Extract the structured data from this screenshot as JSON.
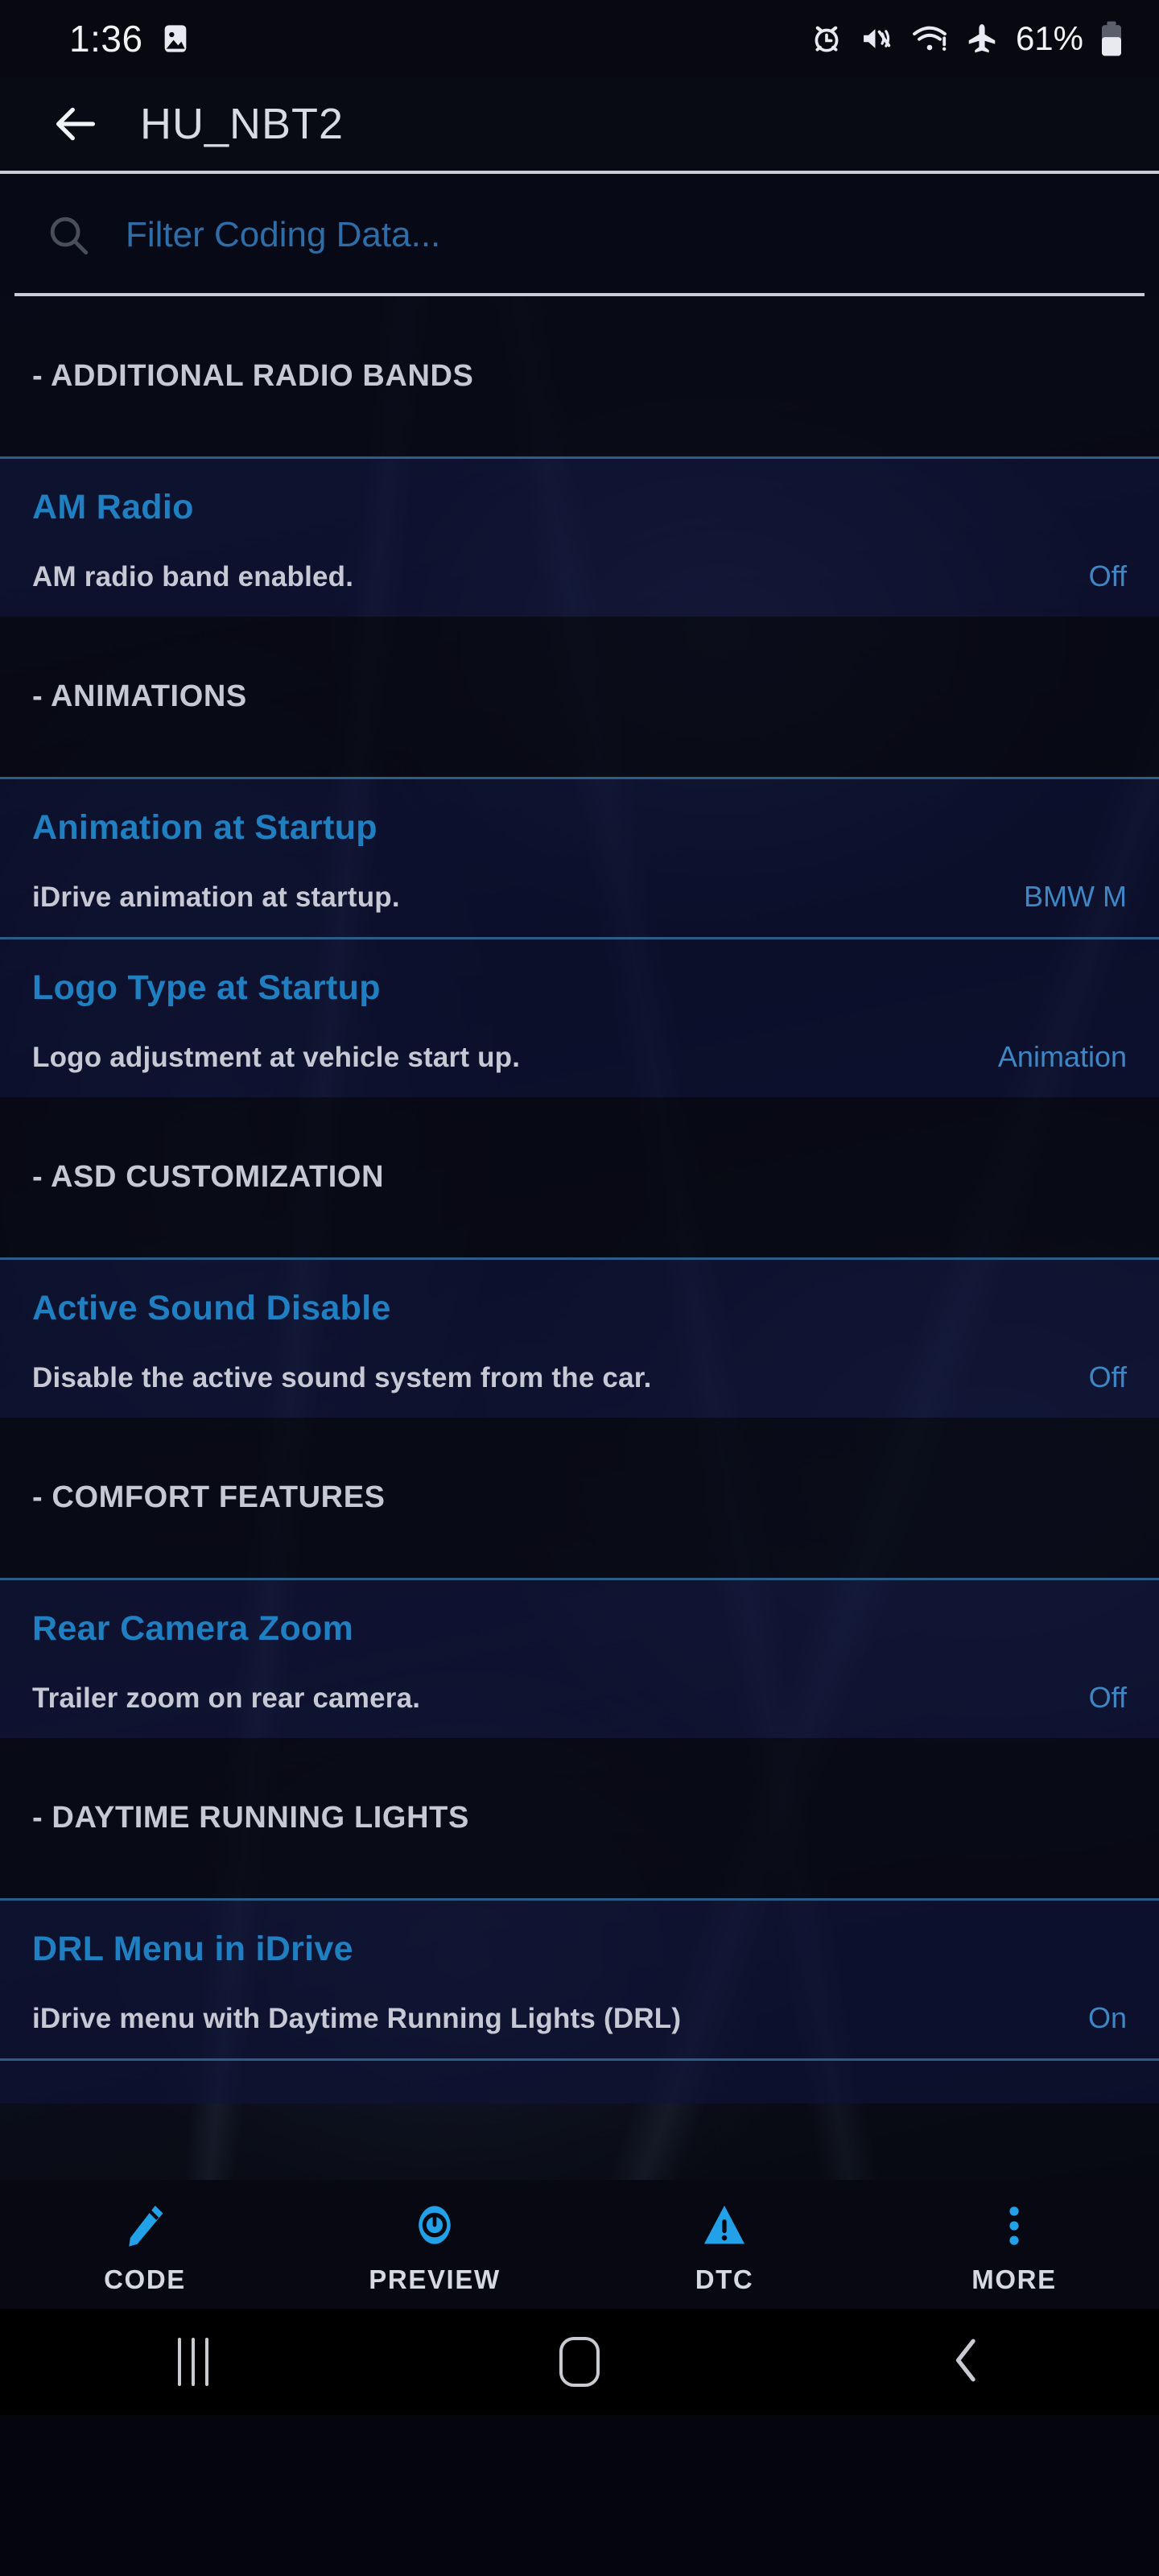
{
  "status_bar": {
    "time": "1:36",
    "battery_percent": "61%",
    "icons": [
      "image-icon",
      "alarm-icon",
      "vibrate-mute-icon",
      "wifi-warning-icon",
      "airplane-mode-icon",
      "battery-icon"
    ]
  },
  "app_bar": {
    "back_icon": "arrow-left-icon",
    "title": "HU_NBT2"
  },
  "search": {
    "icon": "search-icon",
    "value": "",
    "placeholder": "Filter Coding Data..."
  },
  "list": [
    {
      "kind": "section",
      "label": "- ADDITIONAL RADIO BANDS"
    },
    {
      "kind": "item",
      "title": "AM Radio",
      "description": "AM radio band enabled.",
      "value": "Off"
    },
    {
      "kind": "section",
      "label": "- ANIMATIONS"
    },
    {
      "kind": "item",
      "title": "Animation at Startup",
      "description": "iDrive animation at startup.",
      "value": "BMW M"
    },
    {
      "kind": "item",
      "title": "Logo Type at Startup",
      "description": "Logo adjustment at vehicle start up.",
      "value": "Animation"
    },
    {
      "kind": "section",
      "label": "- ASD CUSTOMIZATION"
    },
    {
      "kind": "item",
      "title": "Active Sound Disable",
      "description": "Disable the active sound system from the car.",
      "value": "Off"
    },
    {
      "kind": "section",
      "label": "- COMFORT FEATURES"
    },
    {
      "kind": "item",
      "title": "Rear Camera Zoom",
      "description": "Trailer zoom on rear camera.",
      "value": "Off"
    },
    {
      "kind": "section",
      "label": "- DAYTIME RUNNING LIGHTS"
    },
    {
      "kind": "item",
      "title": "DRL Menu in iDrive",
      "description": "iDrive menu with Daytime Running Lights (DRL)",
      "value": "On"
    }
  ],
  "bottom_tabs": [
    {
      "label": "CODE",
      "icon": "pencil-icon"
    },
    {
      "label": "PREVIEW",
      "icon": "eye-icon"
    },
    {
      "label": "DTC",
      "icon": "warning-triangle-icon"
    },
    {
      "label": "MORE",
      "icon": "dots-vertical-icon"
    }
  ],
  "system_nav": [
    {
      "name": "recents-button",
      "icon": "three-bars-icon"
    },
    {
      "name": "home-button",
      "icon": "rounded-square-icon"
    },
    {
      "name": "back-button",
      "icon": "chevron-left-icon"
    }
  ],
  "colors": {
    "accent_blue": "#1f7fc0",
    "value_blue": "#3f86c4",
    "placeholder_blue": "#2e6da8",
    "divider_blue": "#2a5d88",
    "text_light": "#c6c9d4",
    "row_bg": "#0e143a",
    "page_bg": "#070911",
    "tab_icon_blue": "#22a0e8"
  }
}
